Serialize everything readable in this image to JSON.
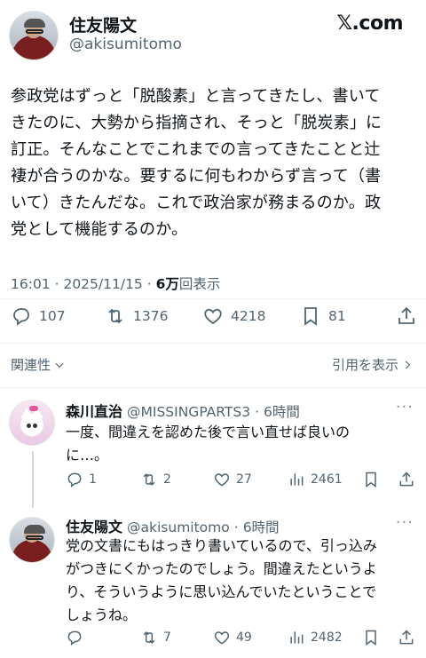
{
  "post": {
    "author_name": "住友陽文",
    "author_handle": "@akisumitomo",
    "brand": "𝕏.com",
    "text": "参政党はずっと「脱酸素」と言ってきたし、書いて\nきたのに、大勢から指摘され、そっと「脱炭素」に\n訂正。そんなことでこれまでの言ってきたことと辻\n褄が合うのかな。要するに何もわからず言って（書\nいて）きたんだな。これで政治家が務まるのか。政\n党として機能するのか。",
    "time": "16:01",
    "date": "2025/11/15",
    "views_count": "6万",
    "views_label": "回表示",
    "replies": "107",
    "reposts": "1376",
    "likes": "4218",
    "bookmarks": "81"
  },
  "links": {
    "related": "関連性",
    "quotes": "引用を表示"
  },
  "replies": [
    {
      "name": "森川直治",
      "handle": "@MISSINGPARTS3",
      "time": "6時間",
      "text": "一度、間違えを認めた後で言い直せば良いの\nに…。",
      "replies": "1",
      "reposts": "2",
      "likes": "27",
      "views": "2461"
    },
    {
      "name": "住友陽文",
      "handle": "@akisumitomo",
      "time": "6時間",
      "text": "党の文書にもはっきり書いているので、引っ込み\nがつきにくかったのでしょう。間違えたというよ\nり、そういうように思い込んでいたということで\nしょうね。",
      "replies": "",
      "reposts": "7",
      "likes": "49",
      "views": "2482"
    }
  ],
  "icons": [
    "reply-icon",
    "repost-icon",
    "like-icon",
    "bookmark-icon",
    "share-icon",
    "views-icon",
    "more-icon",
    "chevron-down-icon",
    "chevron-right-icon"
  ],
  "colors": {
    "text": "#0f1419",
    "secondary": "#536471",
    "divider": "#eff3f4"
  }
}
